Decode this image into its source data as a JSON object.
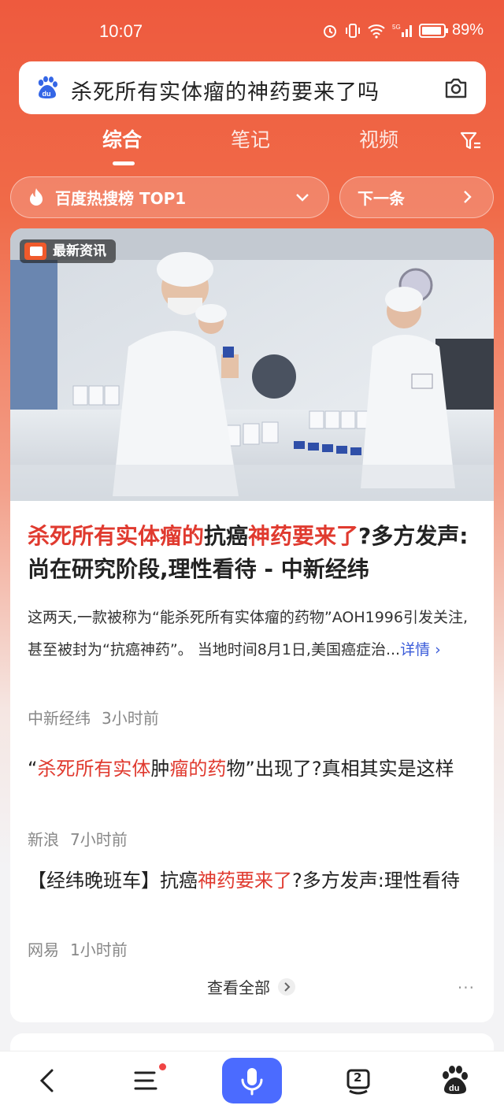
{
  "status_bar": {
    "time": "10:07",
    "battery": "89%",
    "network": "5G",
    "icons": [
      "alarm-icon",
      "vibrate-icon",
      "wifi-icon",
      "signal-icon",
      "battery-icon"
    ]
  },
  "search": {
    "query": "杀死所有实体瘤的神药要来了吗",
    "left_icon": "baidu-logo-icon",
    "right_icon": "camera-icon"
  },
  "tabs": [
    {
      "label": "综合",
      "active": true
    },
    {
      "label": "笔记",
      "active": false
    },
    {
      "label": "视频",
      "active": false
    }
  ],
  "hot_chip": {
    "label": "百度热搜榜 TOP1",
    "icon": "flame-icon"
  },
  "next_chip": {
    "label": "下一条"
  },
  "card": {
    "badge": "最新资讯",
    "headline": {
      "part1": "杀死所有实体瘤的",
      "part2": "抗癌",
      "part3": "神药要来了",
      "part4": "?多方发声:尚在研究阶段,理性看待 - 中新经纬"
    },
    "summary": "这两天,一款被称为“能杀死所有实体瘤的药物”AOH1996引发关注,甚至被封为“抗癌神药”。 当地时间8月1日,美国癌症治...",
    "detail_link": "详情",
    "source": "中新经纬",
    "time": "3小时前",
    "related": [
      {
        "title_parts": [
          "“",
          "杀死所有实体",
          "肿",
          "瘤的药",
          "物”出现了?真相其实是这样"
        ],
        "source": "新浪",
        "time": "7小时前"
      },
      {
        "title_parts": [
          "【经纬晚班车】抗癌",
          "神药要来了",
          "?多方发声:理性看待"
        ],
        "source": "网易",
        "time": "1小时前"
      }
    ],
    "view_all": "查看全部",
    "more": "···"
  },
  "bottom_nav": {
    "items": [
      "back-icon",
      "menu-icon",
      "mic-icon",
      "tabs-icon",
      "baidu-home-icon"
    ],
    "tabs_count": "2"
  }
}
